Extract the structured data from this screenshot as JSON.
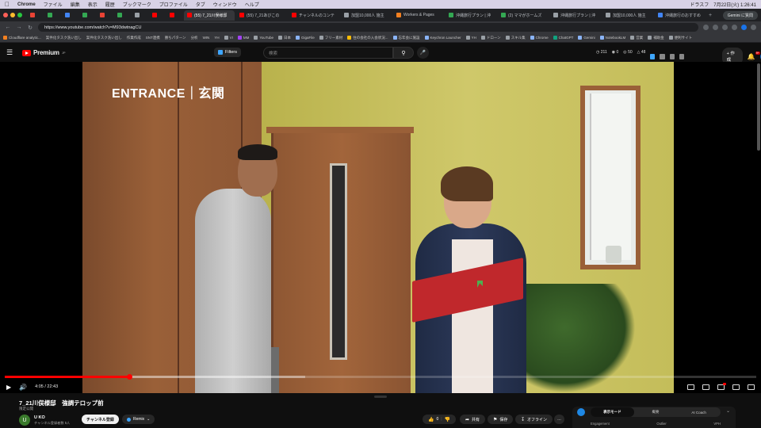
{
  "macbar": {
    "app": "Chrome",
    "menus": [
      "ファイル",
      "編集",
      "表示",
      "履歴",
      "ブックマーク",
      "プロファイル",
      "タブ",
      "ウィンドウ",
      "ヘルプ"
    ],
    "status_item": "ドラスフ",
    "datetime": "7月22日(火)  1:26:41"
  },
  "tabs": [
    {
      "label": ""
    },
    {
      "label": ""
    },
    {
      "label": ""
    },
    {
      "label": ""
    },
    {
      "label": ""
    },
    {
      "label": ""
    },
    {
      "label": ""
    },
    {
      "label": ""
    },
    {
      "label": ""
    },
    {
      "label": "(55) 7_21川俣様邸",
      "active": true
    },
    {
      "label": "(55) 7_21あびこの"
    },
    {
      "label": "チャンネルのコンテ"
    },
    {
      "label": "加盟10,000人 施主"
    },
    {
      "label": "Workers & Pages"
    },
    {
      "label": "沖縄旅行プラン | 沖"
    },
    {
      "label": "(2) ママがホームズ"
    },
    {
      "label": "沖縄旅行プラン | 沖"
    },
    {
      "label": "加盟10,000人 施主"
    },
    {
      "label": "沖縄旅行のおすすめ"
    }
  ],
  "gemini_button": "Gemini に質問",
  "address": {
    "url": "https://www.youtube.com/watch?v=M93dwtnagCU"
  },
  "bookmarks": [
    {
      "label": "Cloudflare analytic..."
    },
    {
      "label": "案件化タスク洗い出し"
    },
    {
      "label": "案件化タスク洗い出し"
    },
    {
      "label": "作業作成"
    },
    {
      "label": "SNT連携"
    },
    {
      "label": "勝ちパターン"
    },
    {
      "label": "分析"
    },
    {
      "label": "WIN"
    },
    {
      "label": "YH"
    },
    {
      "label": "VI",
      "folder": true
    },
    {
      "label": "MM"
    },
    {
      "label": "YouTube",
      "folder": true
    },
    {
      "label": "日本",
      "folder": true
    },
    {
      "label": "GigaFile"
    },
    {
      "label": "フリー素材",
      "folder": true
    },
    {
      "label": "住の会社の入会状況..."
    },
    {
      "label": "忘年会に施設"
    },
    {
      "label": "Keychron Launcher"
    },
    {
      "label": "YH",
      "folder": true
    },
    {
      "label": "ドローン",
      "folder": true
    },
    {
      "label": "スキル集",
      "folder": true
    },
    {
      "label": "Chrome"
    },
    {
      "label": "ChatGPT"
    },
    {
      "label": "Gemini"
    },
    {
      "label": "NotebookLM"
    },
    {
      "label": "営業",
      "folder": true
    },
    {
      "label": "補助金",
      "folder": true
    },
    {
      "label": "便利サイト",
      "folder": true
    }
  ],
  "yt_header": {
    "logo_text": "Premium",
    "logo_sub": "JP",
    "filters_label": "Filters",
    "search_placeholder": "検索",
    "stats": [
      "211",
      "0",
      "50",
      "48"
    ],
    "create_label": "作成",
    "notification_count": "9+"
  },
  "player": {
    "caption": "ENTRANCE｜玄関",
    "current_time": "4:05",
    "duration": "22:43",
    "time_display": "4:05 / 22:43",
    "progress_played_pct": 16.6,
    "progress_loaded_pct": 40.0
  },
  "video": {
    "title": "7_21川俣様邸　強調テロップ前",
    "visibility": "限定公開",
    "channel_initial": "U",
    "channel_name": "U KO",
    "channel_subs": "チャンネル登録者数 5人",
    "subscribe_label": "チャンネル登録",
    "remix_label": "Remix",
    "like_count": "0",
    "share_label": "共有",
    "save_label": "保存",
    "offline_label": "オフライン",
    "more_label": "…"
  },
  "side_panel": {
    "tabs": [
      {
        "label": "表示モード",
        "active": true
      },
      {
        "label": "概要"
      },
      {
        "label": "AI Coach"
      }
    ],
    "metrics": [
      "Engagement",
      "Outlier",
      "VPH"
    ]
  },
  "colors": {
    "yt_red": "#ff0000",
    "bg": "#0f0f0f",
    "accent_blue": "#3ea6ff"
  }
}
